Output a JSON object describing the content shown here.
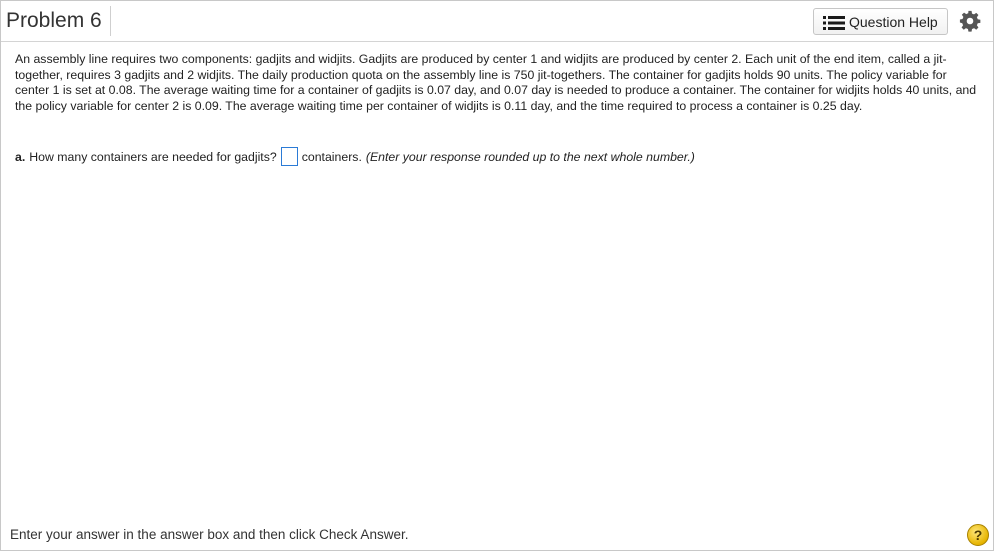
{
  "header": {
    "title": "Problem 6",
    "question_help_label": "Question Help"
  },
  "problem": {
    "text": "An assembly line requires two components: gadjits and widjits. Gadjits are produced by center 1 and widjits are produced by center 2. Each unit of the end item, called a jit-together, requires 3 gadjits and 2 widjits. The daily production quota on the assembly line is 750 jit-togethers. The container for gadjits holds 90 units. The policy variable for center 1 is set at 0.08. The average waiting time for a container of gadjits is 0.07 day, and 0.07 day is needed to produce a container. The container for widjits holds 40 units, and the policy variable for center 2 is 0.09. The average waiting time per container of widjits is 0.11 day, and the time required to process a container is 0.25 day."
  },
  "question": {
    "letter": "a.",
    "prompt": "How many containers are needed for gadjits?",
    "answer_value": "",
    "unit": "containers.",
    "hint": "(Enter your response rounded up to the next whole number.)"
  },
  "footer": {
    "instruction": "Enter your answer in the answer box and then click Check Answer.",
    "help_symbol": "?"
  },
  "icons": {
    "question_help": "list-icon",
    "settings": "gear-icon",
    "help": "question-circle-icon"
  },
  "colors": {
    "answer_box_border": "#2b7bd6",
    "help_circle": "#e6b400"
  }
}
